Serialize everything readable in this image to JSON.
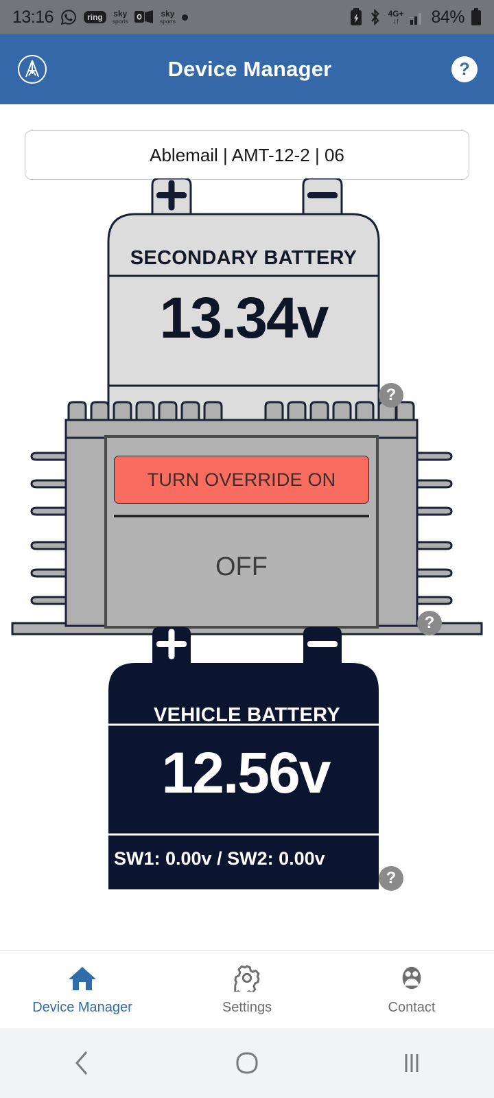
{
  "status_bar": {
    "time": "13:16",
    "left_icons": [
      {
        "name": "whatsapp-icon",
        "label": ""
      },
      {
        "name": "ring-icon",
        "label": "ring"
      },
      {
        "name": "sky-sports-icon",
        "label_top": "sky",
        "label_bottom": "sports"
      },
      {
        "name": "outlook-icon",
        "label": ""
      },
      {
        "name": "sky-sports-icon-2",
        "label_top": "sky",
        "label_bottom": "sports"
      },
      {
        "name": "more-notifications-icon",
        "label": ""
      }
    ],
    "right_icons": [
      {
        "name": "battery-saver-icon"
      },
      {
        "name": "bluetooth-icon"
      },
      {
        "name": "mobile-data-icon",
        "label_top": "4G+",
        "label_bottom": "↓↑"
      },
      {
        "name": "signal-bars-icon"
      }
    ],
    "battery_percent": "84%"
  },
  "header": {
    "logo_name": "ablemail-logo",
    "title": "Device Manager",
    "help_label": "?"
  },
  "device_selector": {
    "value": "Ablemail | AMT-12-2 | 06"
  },
  "secondary_battery": {
    "label": "SECONDARY BATTERY",
    "voltage": "13.34v",
    "terminal_positive": "+",
    "terminal_negative": "−",
    "help_label": "?",
    "body_color": "#dcdcdc",
    "outline_color": "#1b2235",
    "text_color": "#0d1526"
  },
  "charger_module": {
    "override_button_label": "TURN OVERRIDE ON",
    "override_button_color": "#fa6b60",
    "status": "OFF",
    "help_label": "?",
    "heatsink_color": "#b0b0b0",
    "panel_color": "#b3b3b3"
  },
  "vehicle_battery": {
    "label": "VEHICLE BATTERY",
    "voltage": "12.56v",
    "switch_readings": "SW1: 0.00v / SW2: 0.00v",
    "terminal_positive": "+",
    "terminal_negative": "−",
    "help_label": "?",
    "body_color": "#0b1530",
    "text_color": "#ffffff"
  },
  "bottom_nav": {
    "active_color": "#2f6ca8",
    "inactive_color": "#6e6e6e",
    "items": [
      {
        "icon": "home-icon",
        "label": "Device Manager",
        "active": true
      },
      {
        "icon": "gear-icon",
        "label": "Settings",
        "active": false
      },
      {
        "icon": "contacts-icon",
        "label": "Contact",
        "active": false
      }
    ]
  },
  "android_nav": {
    "back_icon": "back-chevron-icon",
    "home_icon": "home-circle-icon",
    "recents_icon": "recent-apps-icon"
  }
}
